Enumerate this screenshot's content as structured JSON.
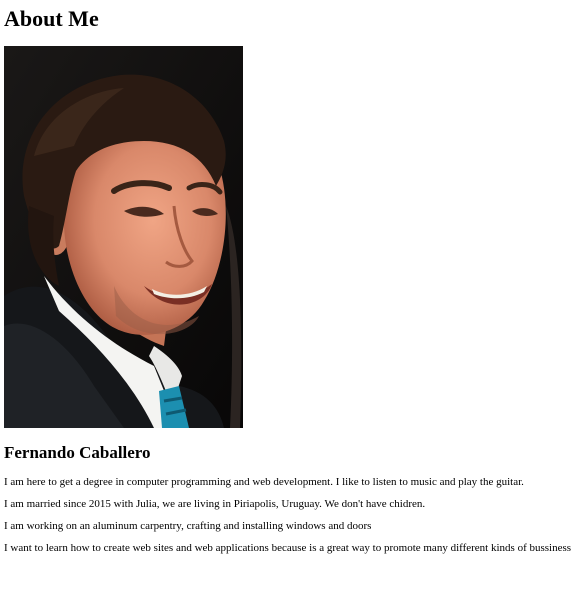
{
  "page": {
    "title": "About Me",
    "name": "Fernando Caballero",
    "paragraphs": [
      "I am here to get a degree in computer programming and web development. I like to listen to music and play the guitar.",
      "I am married since 2015 with Julia, we are living in Piriapolis, Uruguay. We don't have chidren.",
      "I am working on an aluminum carpentry, crafting and installing windows and doors",
      "I want to learn how to create web sites and web applications because is a great way to promote many different kinds of bussiness."
    ]
  },
  "photo": {
    "icon": "portrait-photo",
    "colors": {
      "background": "#0d0c0c",
      "skin": "#d9886a",
      "hair": "#2a1a12",
      "suit": "#15171a",
      "shirt": "#f4f4f2",
      "tie": "#1c8fb0"
    }
  }
}
